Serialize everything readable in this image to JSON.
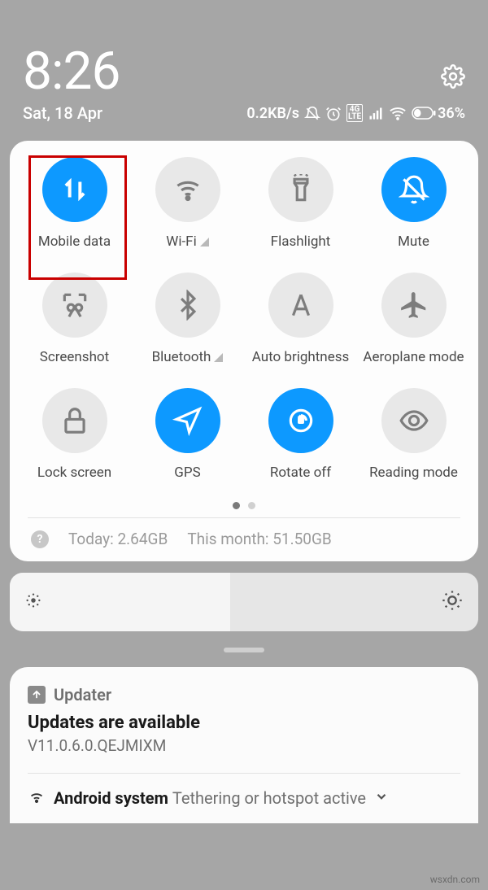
{
  "header": {
    "time": "8:26",
    "date": "Sat, 18 Apr",
    "speed": "0.2KB/s",
    "lte_top": "4G",
    "lte_bot": "LTE",
    "battery": "36%"
  },
  "toggles": [
    {
      "name": "mobile-data",
      "label": "Mobile data",
      "on": true,
      "expandable": false
    },
    {
      "name": "wifi",
      "label": "Wi-Fi",
      "on": false,
      "expandable": true
    },
    {
      "name": "flashlight",
      "label": "Flashlight",
      "on": false,
      "expandable": false
    },
    {
      "name": "mute",
      "label": "Mute",
      "on": true,
      "expandable": false
    },
    {
      "name": "screenshot",
      "label": "Screenshot",
      "on": false,
      "expandable": false
    },
    {
      "name": "bluetooth",
      "label": "Bluetooth",
      "on": false,
      "expandable": true
    },
    {
      "name": "auto-brightness",
      "label": "Auto brightness",
      "on": false,
      "expandable": false
    },
    {
      "name": "aeroplane-mode",
      "label": "Aeroplane mode",
      "on": false,
      "expandable": false
    },
    {
      "name": "lock-screen",
      "label": "Lock screen",
      "on": false,
      "expandable": false
    },
    {
      "name": "gps",
      "label": "GPS",
      "on": true,
      "expandable": false
    },
    {
      "name": "rotate-off",
      "label": "Rotate off",
      "on": true,
      "expandable": false
    },
    {
      "name": "reading-mode",
      "label": "Reading mode",
      "on": false,
      "expandable": false
    }
  ],
  "usage": {
    "today_label": "Today:",
    "today_val": "2.64GB",
    "month_label": "This month:",
    "month_val": "51.50GB"
  },
  "notification": {
    "app": "Updater",
    "title": "Updates are available",
    "subtitle": "V11.0.6.0.QEJMIXM",
    "second_app": "Android system",
    "second_text": "Tethering or hotspot active"
  },
  "watermark": "wsxdn.com"
}
